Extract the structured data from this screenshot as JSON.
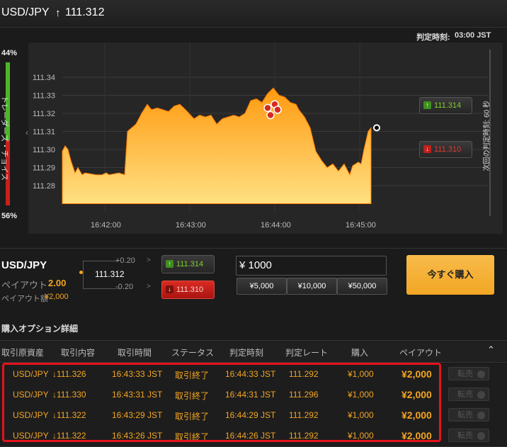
{
  "header": {
    "pair": "USD/JPY",
    "arrow": "↑",
    "rate": "111.312",
    "expiry_label": "判定時刻:",
    "expiry_time": "03:00 JST"
  },
  "sentiment": {
    "top_pct": "44%",
    "bottom_pct": "56%",
    "label": "トレーダーズ・チョイス",
    "colors": {
      "up": "#4db52a",
      "down": "#c8201b"
    }
  },
  "chart_data": {
    "type": "area",
    "ylim": [
      111.27,
      111.345
    ],
    "yticks": [
      "111.34",
      "111.33",
      "111.32",
      "111.31",
      "111.30",
      "111.29",
      "111.28"
    ],
    "xticks": [
      "16:42:00",
      "16:43:00",
      "16:44:00",
      "16:45:00"
    ],
    "x_unit": "seconds since 16:41:30",
    "x": [
      0,
      2,
      4,
      6,
      9,
      11,
      14,
      16,
      24,
      28,
      31,
      33,
      40,
      44,
      46,
      52,
      56,
      60,
      63,
      67,
      71,
      75,
      79,
      83,
      87,
      93,
      97,
      101,
      105,
      109,
      113,
      117,
      121,
      125,
      129,
      133,
      137,
      141,
      145,
      149,
      153,
      157,
      161,
      165,
      167,
      171,
      175,
      179,
      183,
      187,
      191,
      195,
      199,
      203,
      205,
      209,
      211,
      213,
      216,
      218
    ],
    "y": [
      111.299,
      111.302,
      111.3,
      111.294,
      111.287,
      111.29,
      111.286,
      111.287,
      111.286,
      111.286,
      111.287,
      111.286,
      111.287,
      111.286,
      111.31,
      111.314,
      111.32,
      111.325,
      111.322,
      111.323,
      111.322,
      111.321,
      111.324,
      111.325,
      111.322,
      111.317,
      111.319,
      111.318,
      111.319,
      111.314,
      111.317,
      111.318,
      111.319,
      111.318,
      111.32,
      111.327,
      111.328,
      111.326,
      111.331,
      111.334,
      111.33,
      111.329,
      111.326,
      111.325,
      111.322,
      111.318,
      111.312,
      111.299,
      111.294,
      111.29,
      111.292,
      111.288,
      111.292,
      111.286,
      111.291,
      111.293,
      111.292,
      111.3,
      111.31,
      111.312
    ],
    "markers": [
      {
        "x": 145,
        "y": 111.323
      },
      {
        "x": 147,
        "y": 111.319
      },
      {
        "x": 150,
        "y": 111.325
      },
      {
        "x": 152,
        "y": 111.322
      }
    ],
    "last_point": {
      "x": 222,
      "y": 111.312
    },
    "colors": {
      "top": "#ff9a10",
      "bottom": "#ffe082",
      "line": "#ff7a00"
    },
    "next_expiry_label": "次回の判定時刻: 60 秒"
  },
  "chart_buttons": {
    "up_value": "111.314",
    "down_value": "111.310"
  },
  "trade": {
    "pair": "USD/JPY",
    "payout_label": "ペイアウト",
    "payout_value": "2.00",
    "payout_amount_label": "ペイアウト額",
    "payout_amount_value": "¥2,000",
    "current_rate": "111.312",
    "plus": "+0.20",
    "minus": "-0.20",
    "gt": ">",
    "up_value": "111.314",
    "down_value": "111.310",
    "amount": "¥ 1000",
    "quick_amounts": [
      "¥5,000",
      "¥10,000",
      "¥50,000"
    ],
    "buy_label": "今すぐ購入"
  },
  "options": {
    "title": "購入オプション詳細",
    "columns": [
      "取引原資産",
      "取引内容",
      "取引時間",
      "ステータス",
      "判定時刻",
      "判定レート",
      "購入",
      "ペイアウト"
    ],
    "resell_label": "転売",
    "rows": [
      {
        "asset": "USD/JPY",
        "arrow": "↓",
        "content": "111.326",
        "time": "16:43:33 JST",
        "status": "取引終了",
        "expiry": "16:44:33 JST",
        "rate": "111.292",
        "purchase": "¥1,000",
        "payout": "¥2,000"
      },
      {
        "asset": "USD/JPY",
        "arrow": "↓",
        "content": "111.330",
        "time": "16:43:31 JST",
        "status": "取引終了",
        "expiry": "16:44:31 JST",
        "rate": "111.296",
        "purchase": "¥1,000",
        "payout": "¥2,000"
      },
      {
        "asset": "USD/JPY",
        "arrow": "↓",
        "content": "111.322",
        "time": "16:43:29 JST",
        "status": "取引終了",
        "expiry": "16:44:29 JST",
        "rate": "111.292",
        "purchase": "¥1,000",
        "payout": "¥2,000"
      },
      {
        "asset": "USD/JPY",
        "arrow": "↓",
        "content": "111.322",
        "time": "16:43:26 JST",
        "status": "取引終了",
        "expiry": "16:44:26 JST",
        "rate": "111.292",
        "purchase": "¥1,000",
        "payout": "¥2,000"
      }
    ]
  },
  "accent_colors": {
    "orange": "#f3a522",
    "highlight_border": "#e4131b"
  }
}
